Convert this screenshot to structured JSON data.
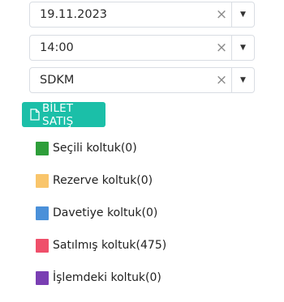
{
  "selects": {
    "date": {
      "value": "19.11.2023",
      "clear_icon": "close-icon",
      "arrow_icon": "caret-down-icon"
    },
    "time": {
      "value": "14:00",
      "clear_icon": "close-icon",
      "arrow_icon": "caret-down-icon"
    },
    "hall": {
      "value": "SDKM",
      "clear_icon": "close-icon",
      "arrow_icon": "caret-down-icon"
    }
  },
  "sell_button": {
    "label": "BİLET SATIŞ",
    "icon": "document-icon",
    "color": "#1bbfa8"
  },
  "legend": {
    "items": [
      {
        "label": "Seçili koltuk(0)",
        "color": "#2e9e3a"
      },
      {
        "label": "Rezerve koltuk(0)",
        "color": "#f9c56b"
      },
      {
        "label": "Davetiye koltuk(0)",
        "color": "#4a90d9"
      },
      {
        "label": "Satılmış koltuk(475)",
        "color": "#ef4f6a"
      },
      {
        "label": "İşlemdeki koltuk(0)",
        "color": "#7a3fb3"
      }
    ]
  },
  "glyphs": {
    "clear": "×",
    "arrow": "▼"
  }
}
